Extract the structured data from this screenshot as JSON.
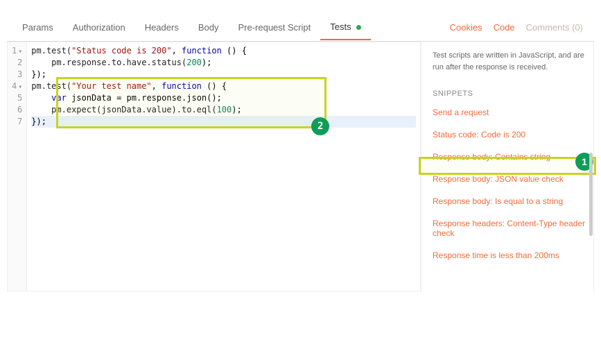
{
  "tabs": {
    "params": "Params",
    "authorization": "Authorization",
    "headers": "Headers",
    "body": "Body",
    "prerequest": "Pre-request Script",
    "tests": "Tests"
  },
  "toplinks": {
    "cookies": "Cookies",
    "code": "Code",
    "comments": "Comments (0)"
  },
  "editor": {
    "lines": [
      "1",
      "2",
      "3",
      "4",
      "5",
      "6",
      "7"
    ],
    "code": {
      "l1": {
        "pre": "pm.test(",
        "str": "\"Status code is 200\"",
        "mid": ", ",
        "kw": "function",
        "post": " () {"
      },
      "l2": {
        "pre": "    pm.response.to.have.status(",
        "num": "200",
        "post": ");"
      },
      "l3": {
        "txt": "});"
      },
      "l4": {
        "pre": "pm.test(",
        "str": "\"Your test name\"",
        "mid": ", ",
        "kw": "function",
        "post": " () {"
      },
      "l5": {
        "pre": "    ",
        "kw": "var",
        "mid": " jsonData = pm.response.json();"
      },
      "l6": {
        "pre": "    pm.expect(jsonData.value).to.eql(",
        "num": "100",
        "post": ");"
      },
      "l7": {
        "txt": "});"
      }
    }
  },
  "sidebar": {
    "hint": "Test scripts are written in JavaScript, and are run after the response is received.",
    "title": "SNIPPETS",
    "snippets": [
      "Send a request",
      "Status code: Code is 200",
      "Response body: Contains string",
      "Response body: JSON value check",
      "Response body: Is equal to a string",
      "Response headers: Content-Type header check",
      "Response time is less than 200ms"
    ]
  },
  "annotations": {
    "badge1": "1",
    "badge2": "2"
  }
}
